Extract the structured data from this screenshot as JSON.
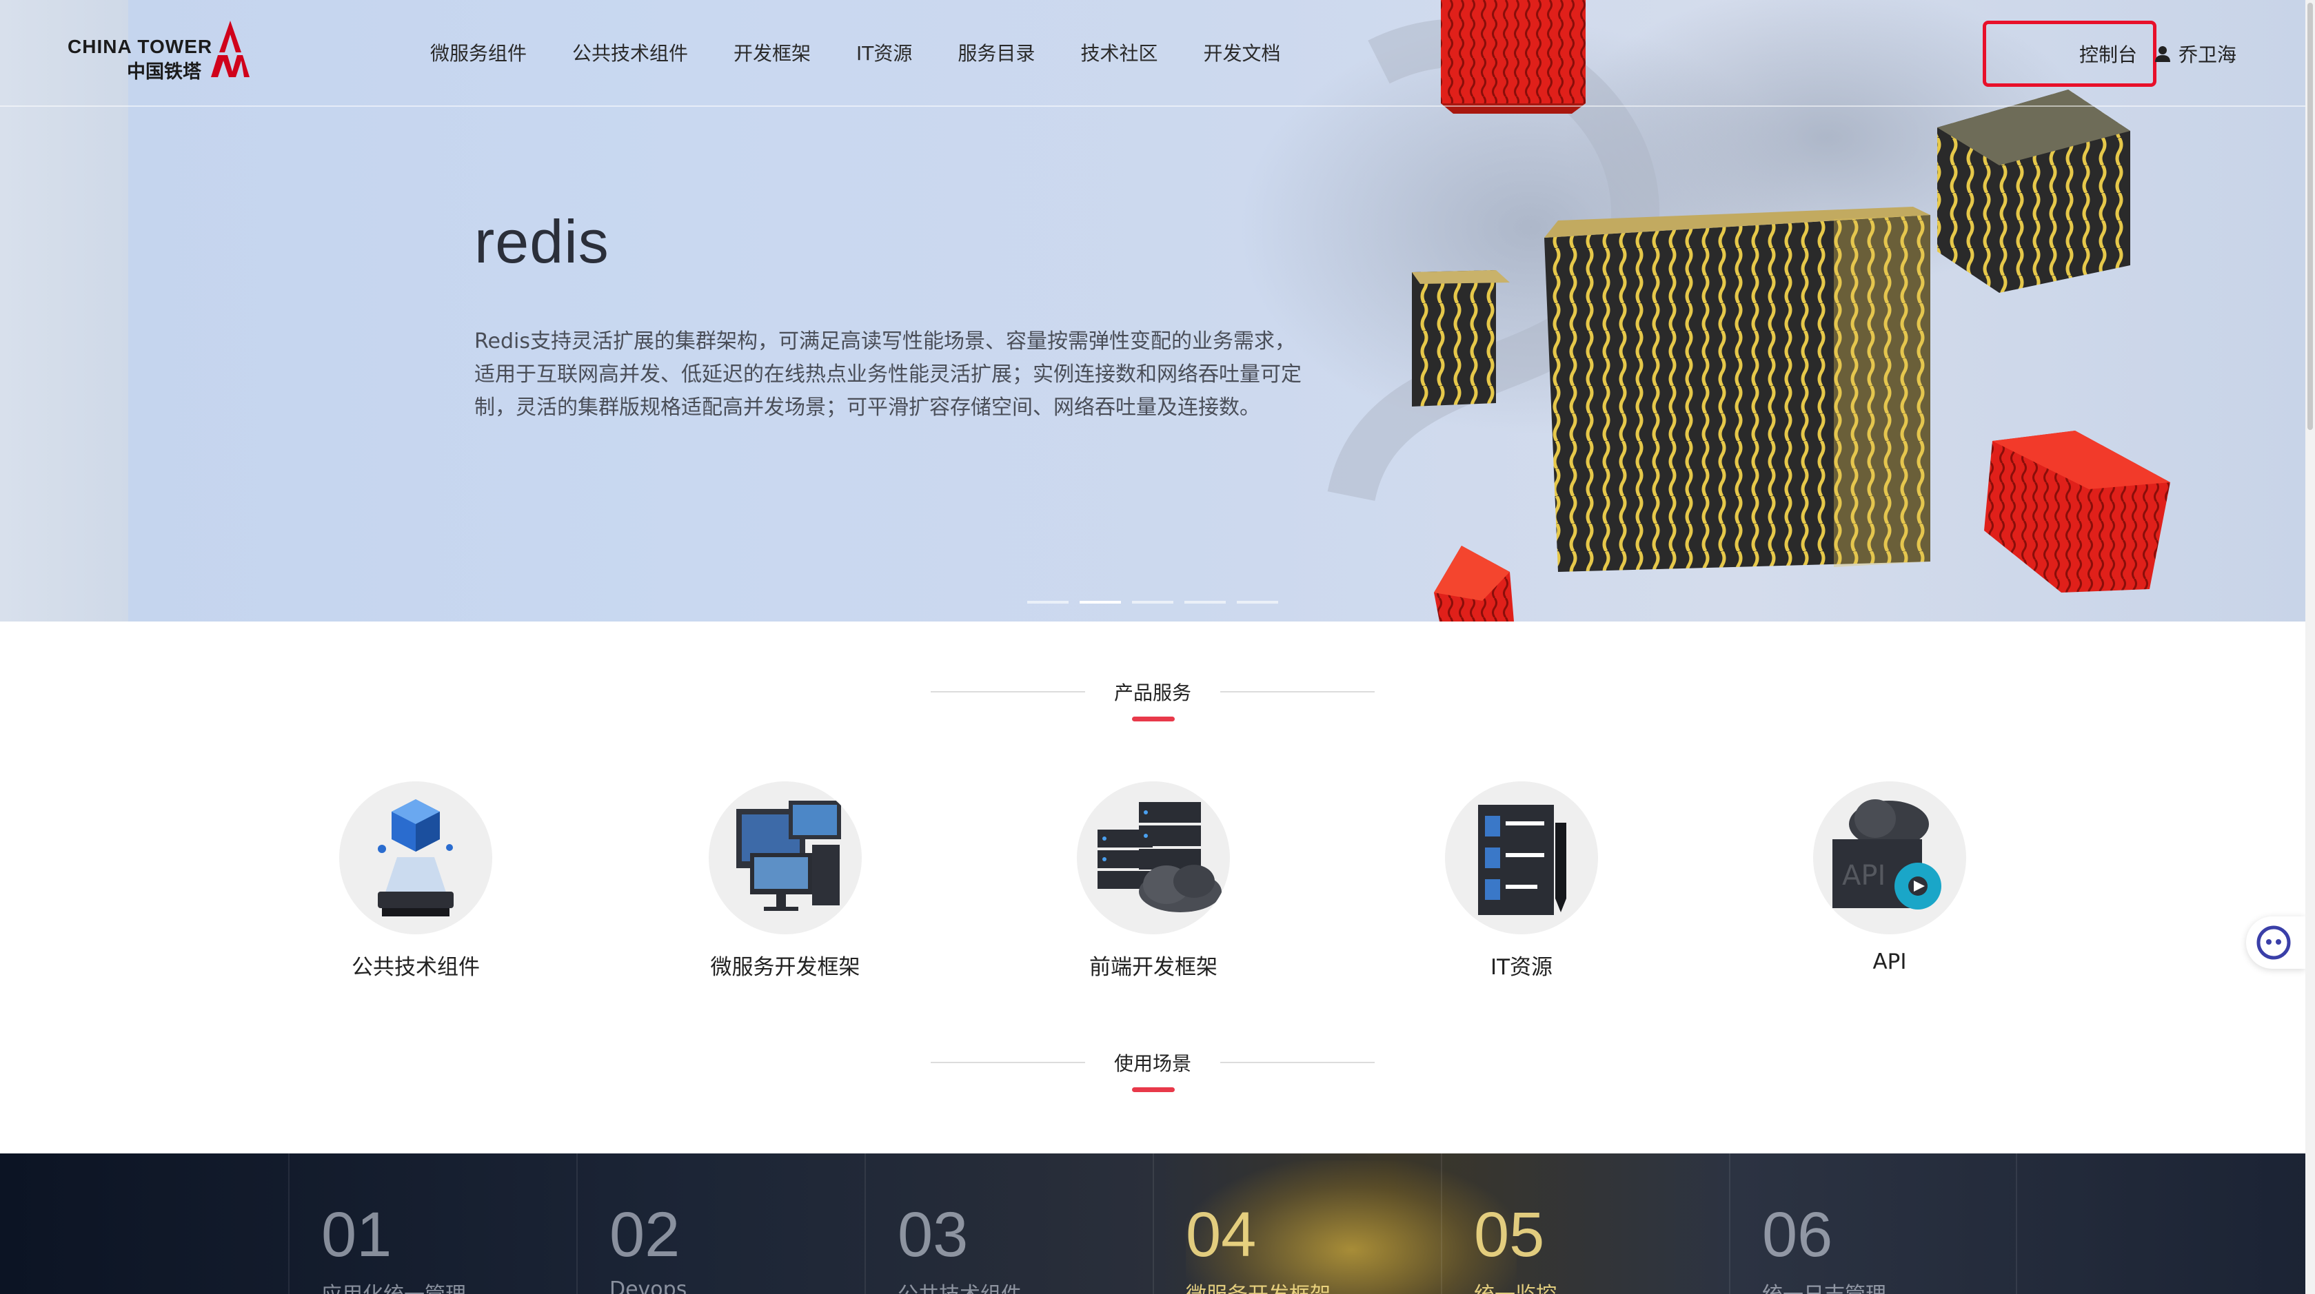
{
  "header": {
    "logo_en": "CHINA TOWER",
    "logo_cn": "中国铁塔",
    "nav": [
      "微服务组件",
      "公共技术组件",
      "开发框架",
      "IT资源",
      "服务目录",
      "技术社区",
      "开发文档"
    ],
    "console": "控制台",
    "user": "乔卫海"
  },
  "hero": {
    "title": "redis",
    "description": "Redis支持灵活扩展的集群架构，可满足高读写性能场景、容量按需弹性变配的业务需求，适用于互联网高并发、低延迟的在线热点业务性能灵活扩展；实例连接数和网络吞吐量可定制，灵活的集群版规格适配高并发场景；可平滑扩容存储空间、网络吞吐量及连接数。",
    "slides": 5,
    "active_slide": 2
  },
  "products": {
    "title": "产品服务",
    "items": [
      {
        "label": "公共技术组件",
        "icon": "hologram-cube-icon"
      },
      {
        "label": "微服务开发框架",
        "icon": "monitors-icon"
      },
      {
        "label": "前端开发框架",
        "icon": "server-cloud-icon"
      },
      {
        "label": "IT资源",
        "icon": "checklist-pen-icon"
      },
      {
        "label": "API",
        "icon": "api-cloud-gear-icon"
      }
    ]
  },
  "scenarios": {
    "title": "使用场景",
    "items": [
      {
        "num": "01",
        "name": "应用化统一管理"
      },
      {
        "num": "02",
        "name": "Devops"
      },
      {
        "num": "03",
        "name": "公共技术组件"
      },
      {
        "num": "04",
        "name": "微服务开发框架"
      },
      {
        "num": "05",
        "name": "统一监控"
      },
      {
        "num": "06",
        "name": "统一日志管理"
      }
    ]
  },
  "colors": {
    "accent": "#e8394a",
    "highlight_box": "#e8102a",
    "brand_red": "#d0021b"
  }
}
